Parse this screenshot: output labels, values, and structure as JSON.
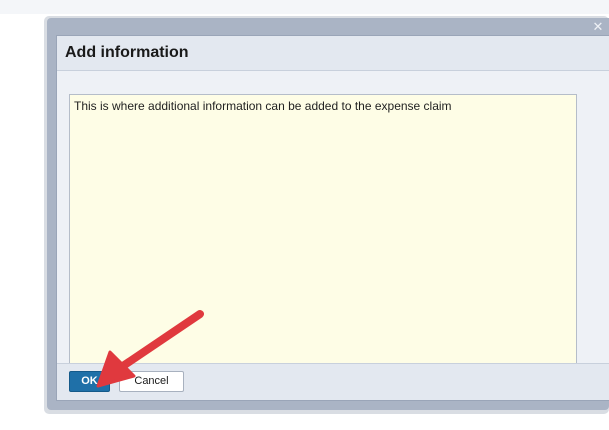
{
  "dialog": {
    "title": "Add information",
    "close_icon": "close-icon",
    "text_value": "This is where additional information can be added to the expense claim",
    "ok_label": "OK",
    "cancel_label": "Cancel"
  },
  "annotation": {
    "arrow_icon": "red-arrow-icon",
    "arrow_color": "#e0393e"
  },
  "colors": {
    "primary_button": "#1f70a8",
    "dialog_frame": "#aab4c5",
    "textarea_background": "#fefde6"
  }
}
